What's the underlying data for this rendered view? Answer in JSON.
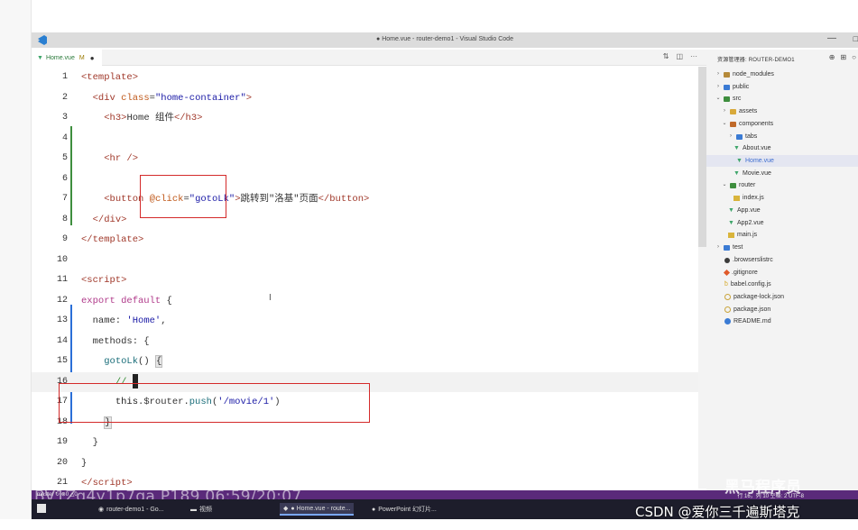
{
  "window": {
    "title": "● Home.vue - router-demo1 - Visual Studio Code",
    "min": "—",
    "max": "□"
  },
  "tab": {
    "icon": "▼",
    "name": "Home.vue",
    "modified": "M",
    "dirty": "●",
    "actions": [
      "⇅",
      "◫",
      "···"
    ]
  },
  "editor": {
    "line_numbers": [
      "1",
      "2",
      "3",
      "4",
      "5",
      "6",
      "7",
      "8",
      "9",
      "10",
      "11",
      "12",
      "13",
      "14",
      "15",
      "16",
      "17",
      "18",
      "19",
      "20",
      "21"
    ]
  },
  "explorer": {
    "header": "资源管理器: ROUTER-DEMO1",
    "actions": [
      "⊕",
      "⊞",
      "○"
    ],
    "items": [
      {
        "name": "node_modules"
      },
      {
        "name": "public"
      },
      {
        "name": "src"
      },
      {
        "name": "assets"
      },
      {
        "name": "components"
      },
      {
        "name": "tabs"
      },
      {
        "name": "About.vue"
      },
      {
        "name": "Home.vue"
      },
      {
        "name": "Movie.vue"
      },
      {
        "name": "router"
      },
      {
        "name": "index.js"
      },
      {
        "name": "App.vue"
      },
      {
        "name": "App2.vue"
      },
      {
        "name": "main.js"
      },
      {
        "name": "test"
      },
      {
        "name": ".browserslistrc"
      },
      {
        "name": ".gitignore"
      },
      {
        "name": "babel.config.js"
      },
      {
        "name": "package-lock.json"
      },
      {
        "name": "package.json"
      },
      {
        "name": "README.md"
      }
    ]
  },
  "statusbar": {
    "left": "master ↻ ⊗0 △0",
    "right": "行 16，列 10   空格: 2   UTF-8"
  },
  "overlay_text": "BV1Zg4y1p7ga P189 06:59/20:07",
  "taskbar": {
    "items": [
      {
        "label": "router-demo1 - Go..."
      },
      {
        "label": "视频"
      },
      {
        "label": "● Home.vue - route..."
      },
      {
        "label": "PowerPoint 幻灯片..."
      }
    ]
  },
  "watermark": {
    "csdn": "CSDN @爱你三千遍斯塔克",
    "brand": "黑马程序员"
  }
}
